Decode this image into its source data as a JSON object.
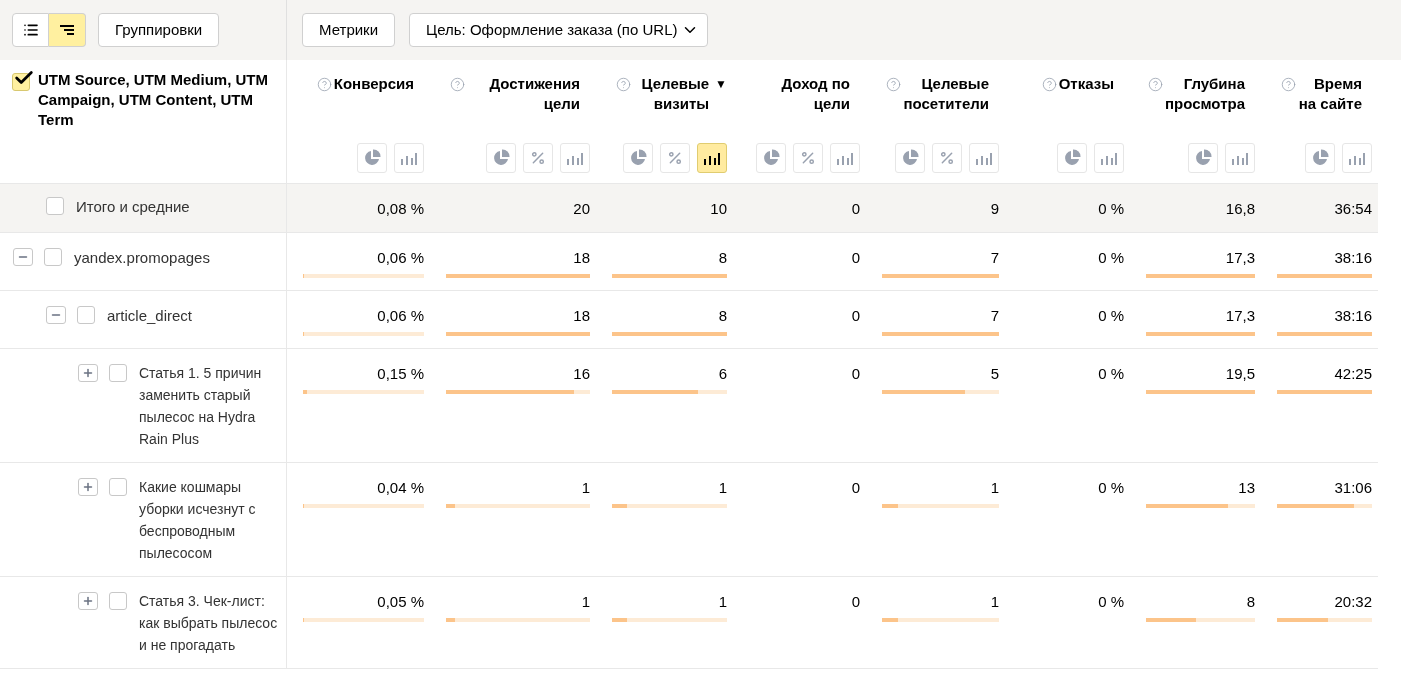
{
  "toolbar": {
    "view_modes": [
      {
        "kind": "list",
        "selected": false
      },
      {
        "kind": "tree",
        "selected": true
      }
    ],
    "groupings_button": "Группировки",
    "metrics_button": "Метрики",
    "goal_select": {
      "value": "Цель: Оформление заказа (по URL)"
    }
  },
  "dimension_header": {
    "label": "UTM Source, UTM Medium, UTM Campaign, UTM Content, UTM Term",
    "checked": true
  },
  "metrics": [
    {
      "label": "Конверсия",
      "help": true,
      "views": [
        {
          "kind": "pie",
          "selected": false
        },
        {
          "kind": "bars",
          "selected": false
        }
      ]
    },
    {
      "label": "Достижения цели",
      "help": true,
      "views": [
        {
          "kind": "pie",
          "selected": false
        },
        {
          "kind": "percent",
          "selected": false
        },
        {
          "kind": "bars",
          "selected": false
        }
      ]
    },
    {
      "label": "Целевые визиты",
      "help": true,
      "sort_mark": "▼",
      "views": [
        {
          "kind": "pie",
          "selected": false
        },
        {
          "kind": "percent",
          "selected": false
        },
        {
          "kind": "bars",
          "selected": true
        }
      ]
    },
    {
      "label": "Доход по цели",
      "help": false,
      "views": [
        {
          "kind": "pie",
          "selected": false
        },
        {
          "kind": "percent",
          "selected": false
        },
        {
          "kind": "bars",
          "selected": false
        }
      ]
    },
    {
      "label": "Целевые посетители",
      "help": true,
      "views": [
        {
          "kind": "pie",
          "selected": false
        },
        {
          "kind": "percent",
          "selected": false
        },
        {
          "kind": "bars",
          "selected": false
        }
      ]
    },
    {
      "label": "Отказы",
      "help": true,
      "views": [
        {
          "kind": "pie",
          "selected": false
        },
        {
          "kind": "bars",
          "selected": false
        }
      ]
    },
    {
      "label": "Глубина просмотра",
      "help": true,
      "views": [
        {
          "kind": "pie",
          "selected": false
        },
        {
          "kind": "bars",
          "selected": false
        }
      ]
    },
    {
      "label": "Время на сайте",
      "help": true,
      "views": [
        {
          "kind": "pie",
          "selected": false
        },
        {
          "kind": "bars",
          "selected": false
        }
      ]
    }
  ],
  "total_row": {
    "label": "Итого и средние",
    "checked": false,
    "cells": [
      {
        "value": "0,08 %"
      },
      {
        "value": "20"
      },
      {
        "value": "10"
      },
      {
        "value": "0"
      },
      {
        "value": "9"
      },
      {
        "value": "0 %"
      },
      {
        "value": "16,8"
      },
      {
        "value": "36:54"
      }
    ]
  },
  "rows": [
    {
      "label": "yandex.promopages",
      "expanded": true,
      "checked": false,
      "cells": [
        {
          "value": "0,06 %",
          "level": 0.01
        },
        {
          "value": "18",
          "level": 1
        },
        {
          "value": "8",
          "level": 1
        },
        {
          "value": "0"
        },
        {
          "value": "7",
          "level": 1
        },
        {
          "value": "0 %"
        },
        {
          "value": "17,3",
          "level": 1
        },
        {
          "value": "38:16",
          "level": 1
        }
      ],
      "children": [
        {
          "label": "article_direct",
          "expanded": true,
          "checked": false,
          "cells": [
            {
              "value": "0,06 %",
              "level": 0.01
            },
            {
              "value": "18",
              "level": 1
            },
            {
              "value": "8",
              "level": 1
            },
            {
              "value": "0"
            },
            {
              "value": "7",
              "level": 1
            },
            {
              "value": "0 %"
            },
            {
              "value": "17,3",
              "level": 1
            },
            {
              "value": "38:16",
              "level": 1
            }
          ],
          "children": [
            {
              "label": "Статья 1. 5 причин заменить старый пылесос на Hydra Rain Plus",
              "expanded": false,
              "checked": false,
              "cells": [
                {
                  "value": "0,15 %",
                  "level": 0.03
                },
                {
                  "value": "16",
                  "level": 0.89
                },
                {
                  "value": "6",
                  "level": 0.75
                },
                {
                  "value": "0"
                },
                {
                  "value": "5",
                  "level": 0.71
                },
                {
                  "value": "0 %"
                },
                {
                  "value": "19,5",
                  "level": 1
                },
                {
                  "value": "42:25",
                  "level": 1
                }
              ]
            },
            {
              "label": "Какие кошмары уборки исчезнут с беспроводным пылесосом",
              "expanded": false,
              "checked": false,
              "cells": [
                {
                  "value": "0,04 %",
                  "level": 0.01
                },
                {
                  "value": "1",
                  "level": 0.06
                },
                {
                  "value": "1",
                  "level": 0.13
                },
                {
                  "value": "0"
                },
                {
                  "value": "1",
                  "level": 0.14
                },
                {
                  "value": "0 %"
                },
                {
                  "value": "13",
                  "level": 0.75
                },
                {
                  "value": "31:06",
                  "level": 0.81
                }
              ]
            },
            {
              "label": "Статья 3. Чек-лист: как выбрать пылесос и не прогадать",
              "expanded": false,
              "checked": false,
              "cells": [
                {
                  "value": "0,05 %",
                  "level": 0.01
                },
                {
                  "value": "1",
                  "level": 0.06
                },
                {
                  "value": "1",
                  "level": 0.13
                },
                {
                  "value": "0"
                },
                {
                  "value": "1",
                  "level": 0.14
                },
                {
                  "value": "0 %"
                },
                {
                  "value": "8",
                  "level": 0.46
                },
                {
                  "value": "20:32",
                  "level": 0.54
                }
              ]
            }
          ]
        }
      ]
    }
  ]
}
